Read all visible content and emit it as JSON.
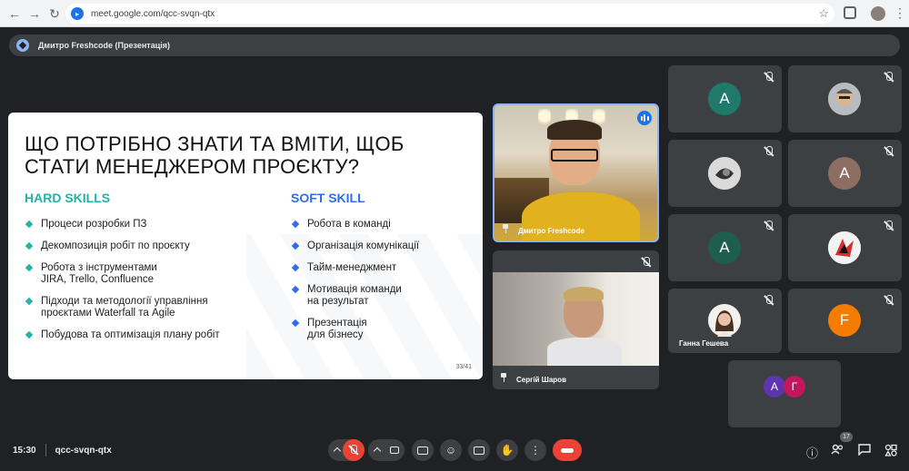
{
  "browser": {
    "url": "meet.google.com/qcc-svqn-qtx",
    "site_icon": "meet-icon"
  },
  "presenter_bar": {
    "label": "Дмитро Freshcode (Презентація)"
  },
  "slide": {
    "title_line1": "ЩО ПОТРІБНО ЗНАТИ ТА ВМІТИ, ЩОБ",
    "title_line2": "СТАТИ МЕНЕДЖЕРОМ ПРОЄКТУ?",
    "hard_heading": "HARD SKILLS",
    "soft_heading": "SOFT SKILL",
    "hard_skills": [
      "Процеси розробки ПЗ",
      "Декомпозиція робіт по проєкту",
      "Робота з інструментами JIRA, Trello, Confluence",
      "Підходи та методології управління проєктами Waterfall та Agile",
      "Побудова та оптимізація плану робіт"
    ],
    "soft_skills": [
      "Робота в команді",
      "Організація комунікації",
      "Тайм-менеджмент",
      "Мотивація команди на результат",
      "Презентація для бізнесу"
    ],
    "page": "33/41"
  },
  "participants": {
    "presenter_video": {
      "name": "Дмитро Freshcode"
    },
    "second_video": {
      "name": "Сергій Шаров"
    },
    "grid": [
      {
        "initial": "А",
        "color": "#1f7a6c"
      },
      {
        "initial": "",
        "color": "#b8bcc0"
      },
      {
        "initial": "",
        "color": "#dadada"
      },
      {
        "initial": "А",
        "color": "#8d6e63"
      },
      {
        "initial": "А",
        "color": "#1e5e50"
      },
      {
        "initial": "",
        "color": "#f2f2f2"
      },
      {
        "initial": "",
        "color": "#c4a486",
        "name": "Ганна Гешева"
      },
      {
        "initial": "F",
        "color": "#f57c00"
      }
    ],
    "overflow": [
      {
        "initial": "А",
        "color": "#5e35b1"
      },
      {
        "initial": "Г",
        "color": "#c2185b"
      }
    ]
  },
  "toolbar": {
    "time": "15:30",
    "meeting_code": "qcc-svqn-qtx",
    "participant_count": "17"
  }
}
